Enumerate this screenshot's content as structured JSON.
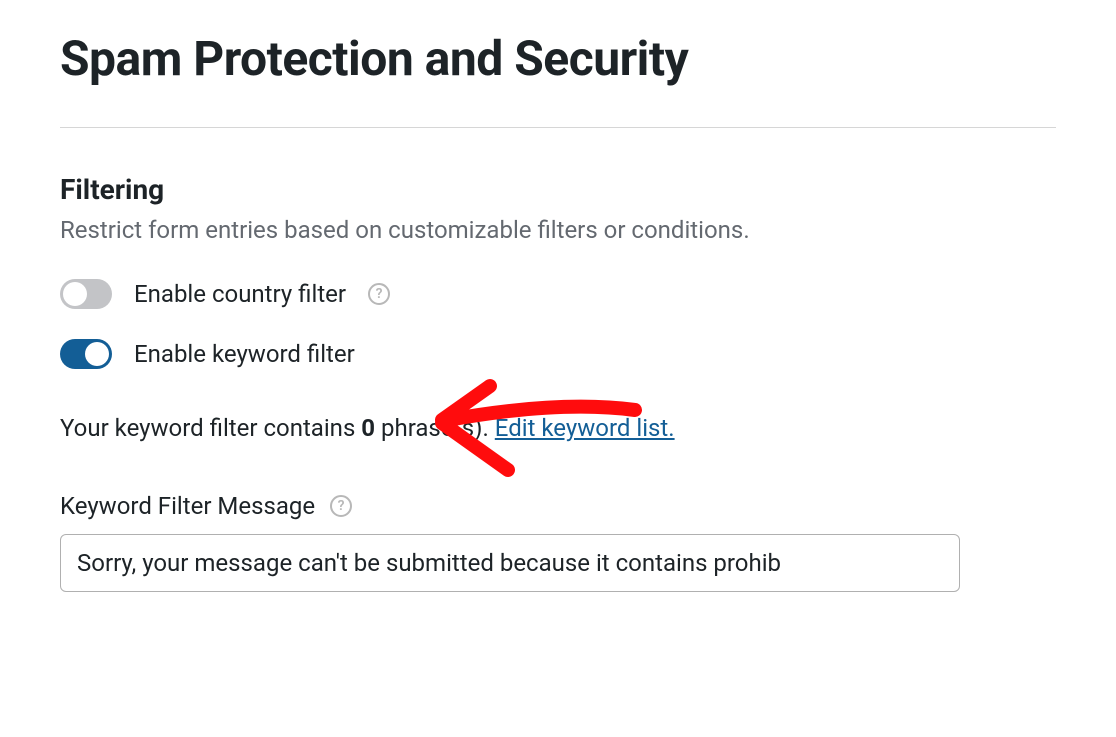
{
  "header": {
    "title": "Spam Protection and Security"
  },
  "filtering": {
    "section_title": "Filtering",
    "section_desc": "Restrict form entries based on customizable filters or conditions.",
    "country_filter": {
      "label": "Enable country filter",
      "enabled": false
    },
    "keyword_filter": {
      "label": "Enable keyword filter",
      "enabled": true,
      "status_prefix": "Your keyword filter contains ",
      "count": "0",
      "status_suffix": " phrase(s). ",
      "edit_link": "Edit keyword list."
    },
    "keyword_message": {
      "label": "Keyword Filter Message",
      "value": "Sorry, your message can't be submitted because it contains prohib"
    }
  },
  "colors": {
    "accent": "#135e96",
    "annotation": "#ff0c0d"
  }
}
